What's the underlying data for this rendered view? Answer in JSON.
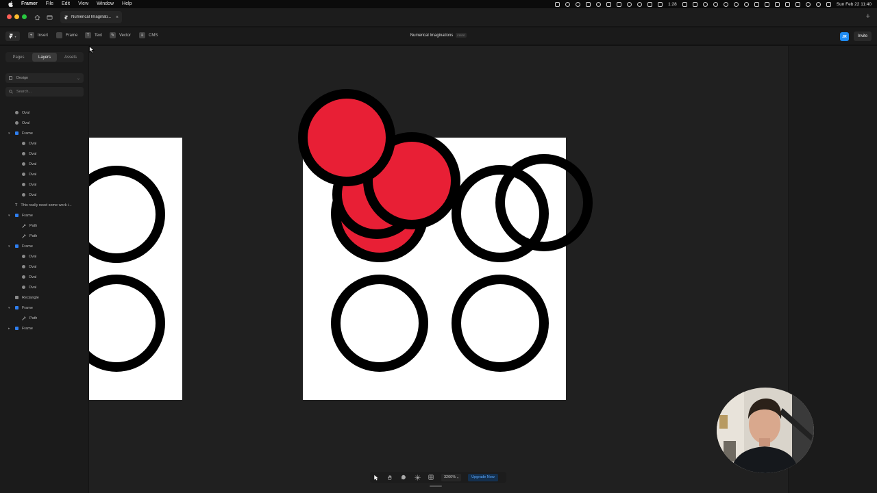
{
  "menubar": {
    "app_name": "Framer",
    "items": [
      "File",
      "Edit",
      "View",
      "Window",
      "Help"
    ],
    "battery_time": "1:28",
    "datetime": "Sun Feb 22  11:40"
  },
  "browser": {
    "tab_title": "Numerical Imaginati...",
    "tab_close": "×",
    "new_tab": "+"
  },
  "toolbar": {
    "tools": [
      {
        "label": "Insert",
        "icon": "plus-icon"
      },
      {
        "label": "Frame",
        "icon": "frame-icon"
      },
      {
        "label": "Text",
        "icon": "text-icon"
      },
      {
        "label": "Vector",
        "icon": "pen-icon"
      },
      {
        "label": "CMS",
        "icon": "database-icon"
      }
    ],
    "project_title": "Numerical Imaginations",
    "plan_badge": "FREE",
    "avatar_initials": "JR",
    "invite_label": "Invite"
  },
  "sidebar": {
    "tabs": [
      "Pages",
      "Layers",
      "Assets"
    ],
    "active_tab": "Layers",
    "page_select": "Design",
    "search_placeholder": "Search...",
    "layers": [
      {
        "type": "oval",
        "label": "Oval",
        "depth": 0
      },
      {
        "type": "oval",
        "label": "Oval",
        "depth": 0
      },
      {
        "type": "frame",
        "label": "Frame",
        "depth": 0,
        "expanded": true
      },
      {
        "type": "oval",
        "label": "Oval",
        "depth": 1
      },
      {
        "type": "oval",
        "label": "Oval",
        "depth": 1
      },
      {
        "type": "oval",
        "label": "Oval",
        "depth": 1
      },
      {
        "type": "oval",
        "label": "Oval",
        "depth": 1
      },
      {
        "type": "oval",
        "label": "Oval",
        "depth": 1
      },
      {
        "type": "oval",
        "label": "Oval",
        "depth": 1
      },
      {
        "type": "text",
        "label": "This really need some work i...",
        "depth": 0
      },
      {
        "type": "frame",
        "label": "Frame",
        "depth": 0,
        "expanded": true
      },
      {
        "type": "path",
        "label": "Path",
        "depth": 1
      },
      {
        "type": "path",
        "label": "Path",
        "depth": 1
      },
      {
        "type": "frame",
        "label": "Frame",
        "depth": 0,
        "expanded": true
      },
      {
        "type": "oval",
        "label": "Oval",
        "depth": 1
      },
      {
        "type": "oval",
        "label": "Oval",
        "depth": 1
      },
      {
        "type": "oval",
        "label": "Oval",
        "depth": 1
      },
      {
        "type": "oval",
        "label": "Oval",
        "depth": 1
      },
      {
        "type": "rect",
        "label": "Rectangle",
        "depth": 0
      },
      {
        "type": "frame",
        "label": "Frame",
        "depth": 0,
        "expanded": true
      },
      {
        "type": "path",
        "label": "Path",
        "depth": 1
      },
      {
        "type": "frame",
        "label": "Frame",
        "depth": 0,
        "expanded": false
      }
    ]
  },
  "bottombar": {
    "zoom": "3200%",
    "upgrade_label": "Upgrade Now"
  },
  "colors": {
    "accent_blue": "#2f7ff0",
    "shape_red": "#e81f35",
    "canvas_bg": "#202020"
  }
}
